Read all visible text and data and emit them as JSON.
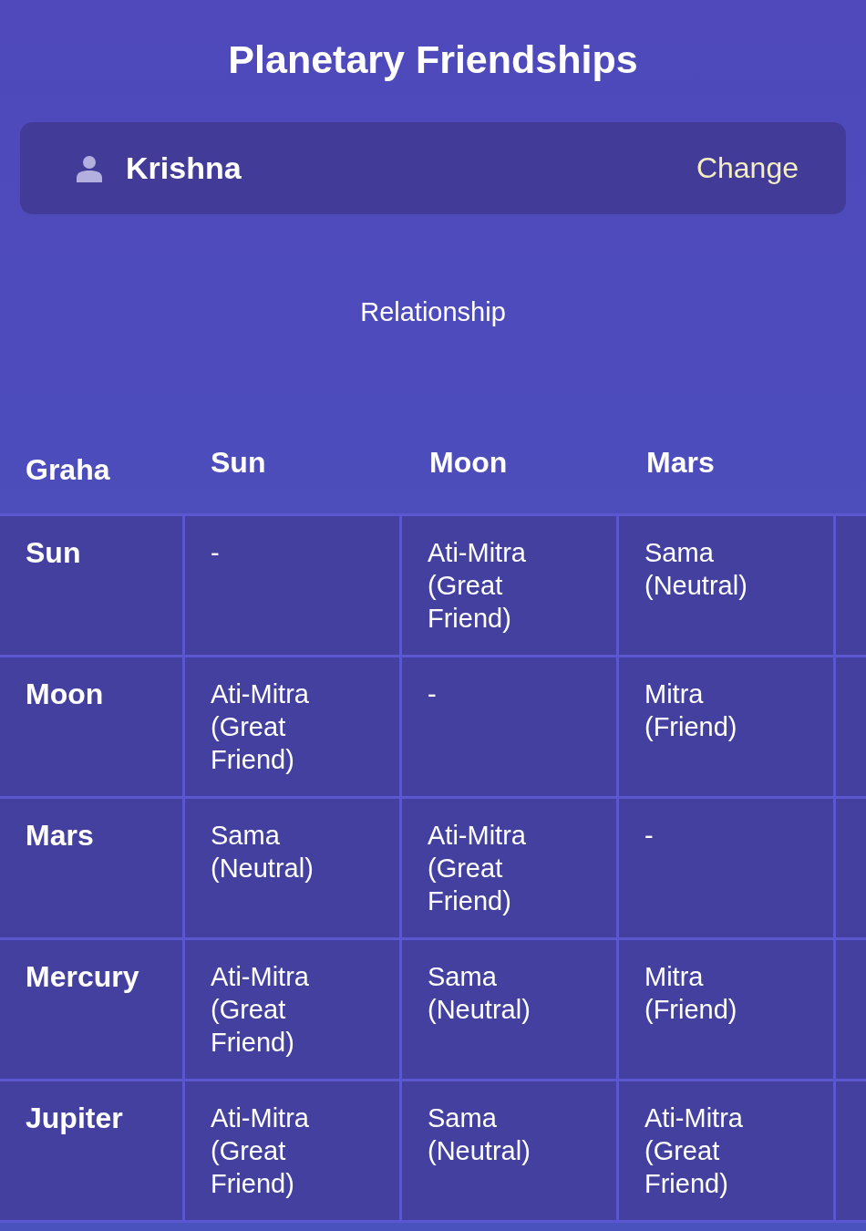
{
  "title": "Planetary Friendships",
  "profile": {
    "name": "Krishna",
    "action": "Change"
  },
  "subtitle": "Relationship",
  "table": {
    "columns": [
      "Graha",
      "Sun",
      "Moon",
      "Mars"
    ],
    "rows": [
      {
        "cells": [
          "Sun",
          "-",
          "Ati-Mitra (Great Friend)",
          "Sama (Neutral)"
        ]
      },
      {
        "cells": [
          "Moon",
          "Ati-Mitra (Great Friend)",
          "-",
          "Mitra (Friend)"
        ]
      },
      {
        "cells": [
          "Mars",
          "Sama (Neutral)",
          "Ati-Mitra (Great Friend)",
          "-"
        ]
      },
      {
        "cells": [
          "Mercury",
          "Ati-Mitra (Great Friend)",
          "Sama (Neutral)",
          "Mitra (Friend)"
        ]
      },
      {
        "cells": [
          "Jupiter",
          "Ati-Mitra (Great Friend)",
          "Sama (Neutral)",
          "Ati-Mitra (Great Friend)"
        ]
      }
    ]
  }
}
